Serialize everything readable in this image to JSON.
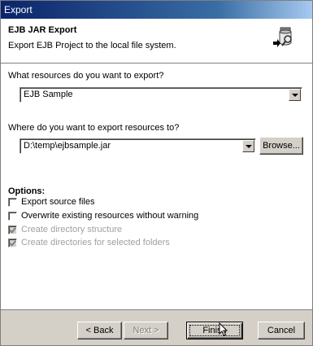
{
  "window": {
    "title": "Export"
  },
  "banner": {
    "title": "EJB JAR Export",
    "description": "Export EJB Project to the local file system.",
    "icon": "export-jar-icon"
  },
  "resources": {
    "label": "What resources do you want to export?",
    "selected": "EJB Sample"
  },
  "destination": {
    "label": "Where do you want to export resources to?",
    "path": "D:\\temp\\ejbsample.jar",
    "browse_label": "Browse..."
  },
  "options": {
    "heading": "Options:",
    "items": [
      {
        "label": "Export source files",
        "checked": false,
        "enabled": true
      },
      {
        "label": "Overwrite existing resources without warning",
        "checked": false,
        "enabled": true
      },
      {
        "label": "Create directory structure",
        "checked": true,
        "enabled": false
      },
      {
        "label": "Create directories for selected folders",
        "checked": true,
        "enabled": false
      }
    ]
  },
  "buttons": {
    "back": "< Back",
    "next": "Next >",
    "finish": "Finish",
    "cancel": "Cancel"
  }
}
